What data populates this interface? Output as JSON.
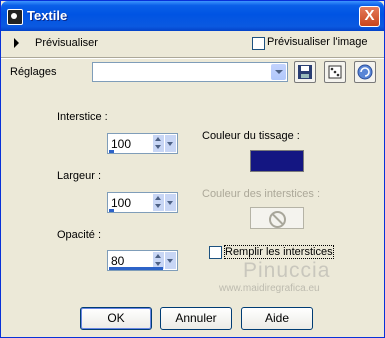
{
  "window": {
    "title": "Textile",
    "close_label": "X"
  },
  "preview": {
    "label": "Prévisualiser",
    "image_checkbox_label": "Prévisualiser l'image",
    "image_checked": false
  },
  "settings": {
    "label": "Réglages",
    "value": ""
  },
  "interstice": {
    "label": "Interstice :",
    "value": "100"
  },
  "largeur": {
    "label": "Largeur :",
    "value": "100"
  },
  "opacite": {
    "label": "Opacité :",
    "value": "80"
  },
  "couleur_tissage": {
    "label": "Couleur du tissage :",
    "color": "#141682"
  },
  "couleur_interstices": {
    "label": "Couleur des interstices :"
  },
  "remplir": {
    "label": "Remplir les interstices",
    "checked": false
  },
  "watermark": {
    "line1": "Pinuccia",
    "line2": "www.maidiregrafica.eu"
  },
  "buttons": {
    "ok": "OK",
    "cancel": "Annuler",
    "help": "Aide"
  },
  "icons": [
    "title-icon",
    "expand-triangle-icon",
    "save-icon",
    "dice-icon",
    "reset-icon",
    "no-color-icon"
  ]
}
